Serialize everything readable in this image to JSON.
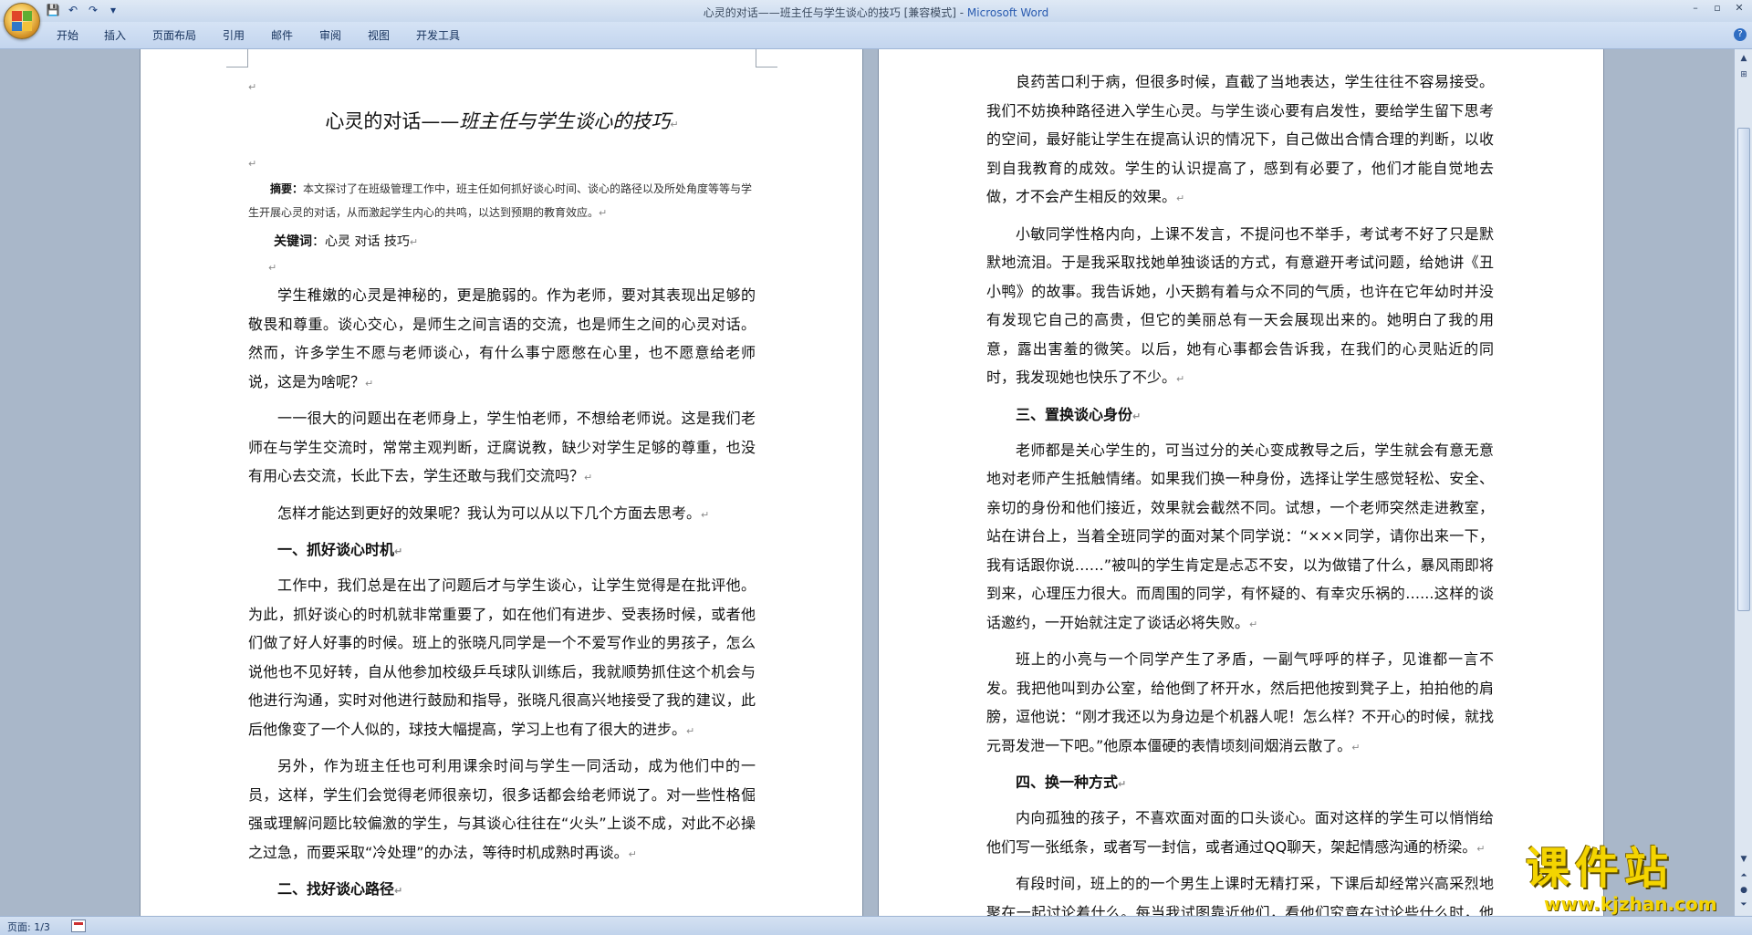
{
  "window": {
    "title": "心灵的对话——班主任与学生谈心的技巧 [兼容模式] - ",
    "app_name": "Microsoft Word"
  },
  "qat": {
    "save_icon": "💾",
    "undo_icon": "↶",
    "redo_icon": "↷",
    "dropdown_icon": "▾"
  },
  "ribbon": {
    "tabs": [
      "开始",
      "插入",
      "页面布局",
      "引用",
      "邮件",
      "审阅",
      "视图",
      "开发工具"
    ]
  },
  "colors": {
    "office_red": "#e0442a",
    "office_green": "#5fae32",
    "office_blue": "#2f78c8",
    "office_yellow": "#f2c13a"
  },
  "page1": {
    "title_main": "心灵的对话——",
    "title_italic": "班主任与学生谈心的技巧",
    "abstract_label": "摘要：",
    "abstract_text": "本文探讨了在班级管理工作中，班主任如何抓好谈心时间、谈心的路径以及所处角度等等与学生开展心灵的对话，从而激起学生内心的共鸣，以达到预期的教育效应。",
    "keywords_label": "关键词",
    "keywords_text": "：心灵  对话  技巧",
    "paragraphs": [
      "学生稚嫩的心灵是神秘的，更是脆弱的。作为老师，要对其表现出足够的敬畏和尊重。谈心交心，是师生之间言语的交流，也是师生之间的心灵对话。然而，许多学生不愿与老师谈心，有什么事宁愿憋在心里，也不愿意给老师说，这是为啥呢？",
      "一一很大的问题出在老师身上，学生怕老师，不想给老师说。这是我们老师在与学生交流时，常常主观判断，迂腐说教，缺少对学生足够的尊重，也没有用心去交流，长此下去，学生还敢与我们交流吗？",
      "怎样才能达到更好的效果呢？我认为可以从以下几个方面去思考。"
    ],
    "heading1": "一、抓好谈心时机",
    "paragraphs_b": [
      "工作中，我们总是在出了问题后才与学生谈心，让学生觉得是在批评他。为此，抓好谈心的时机就非常重要了，如在他们有进步、受表扬时候，或者他们做了好人好事的时候。班上的张晓凡同学是一个不爱写作业的男孩子，怎么说他也不见好转，自从他参加校级乒乓球队训练后，我就顺势抓住这个机会与他进行沟通，实时对他进行鼓励和指导，张晓凡很高兴地接受了我的建议，此后他像变了一个人似的，球技大幅提高，学习上也有了很大的进步。",
      "另外，作为班主任也可利用课余时间与学生一同活动，成为他们中的一员，这样，学生们会觉得老师很亲切，很多话都会给老师说了。对一些性格倔强或理解问题比较偏激的学生，与其谈心往往在“火头”上谈不成，对此不必操之过急，而要采取“冷处理”的办法，等待时机成熟时再谈。"
    ],
    "heading2": "二、找好谈心路径"
  },
  "page2": {
    "paragraphs_a": [
      "良药苦口利于病，但很多时候，直截了当地表达，学生往往不容易接受。我们不妨换种路径进入学生心灵。与学生谈心要有启发性，要给学生留下思考的空间，最好能让学生在提高认识的情况下，自己做出合情合理的判断，以收到自我教育的成效。学生的认识提高了，感到有必要了，他们才能自觉地去做，才不会产生相反的效果。",
      "小敏同学性格内向，上课不发言，不提问也不举手，考试考不好了只是默默地流泪。于是我采取找她单独谈话的方式，有意避开考试问题，给她讲《丑小鸭》的故事。我告诉她，小天鹅有着与众不同的气质，也许在它年幼时并没有发现它自己的高贵，但它的美丽总有一天会展现出来的。她明白了我的用意，露出害羞的微笑。以后，她有心事都会告诉我，在我们的心灵贴近的同时，我发现她也快乐了不少。"
    ],
    "heading3": "三、置换谈心身份",
    "paragraphs_b": [
      "老师都是关心学生的，可当过分的关心变成教导之后，学生就会有意无意地对老师产生抵触情绪。如果我们换一种身份，选择让学生感觉轻松、安全、亲切的身份和他们接近，效果就会截然不同。试想，一个老师突然走进教室，站在讲台上，当着全班同学的面对某个同学说：“×××同学，请你出来一下，我有话跟你说……”被叫的学生肯定是忐忑不安，以为做错了什么，暴风雨即将到来，心理压力很大。而周围的同学，有怀疑的、有幸灾乐祸的…...这样的谈话邀约，一开始就注定了谈话必将失败。",
      "班上的小亮与一个同学产生了矛盾，一副气呼呼的样子，见谁都一言不发。我把他叫到办公室，给他倒了杯开水，然后把他按到凳子上，拍拍他的肩膀，逗他说：“刚才我还以为身边是个机器人呢！怎么样？不开心的时候，就找元哥发泄一下吧。”他原本僵硬的表情顷刻间烟消云散了。"
    ],
    "heading4": "四、换一种方式",
    "paragraphs_c": [
      "内向孤独的孩子，不喜欢面对面的口头谈心。面对这样的学生可以悄悄给他们写一张纸条，或者写一封信，或者通过QQ聊天，架起情感沟通的桥梁。",
      "有段时间，班上的的一个男生上课时无精打采，下课后却经常兴高采烈地聚在一起讨论着什么。每当我试图靠近他们，看他们究竟在讨论些什么时，他们"
    ]
  },
  "status": {
    "page_info": "页面: 1/3"
  },
  "watermark": {
    "name": "课件站",
    "url": "www.kjzhan.com"
  },
  "para_mark": "↵"
}
